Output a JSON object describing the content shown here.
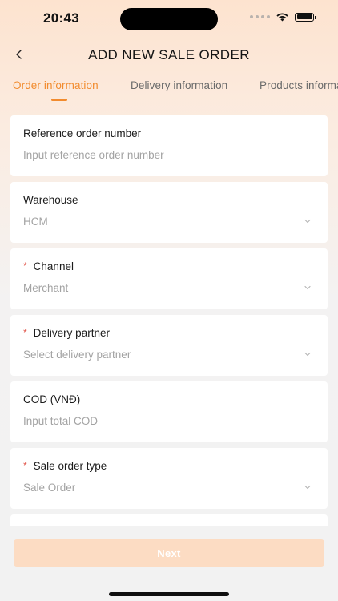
{
  "status_bar": {
    "time": "20:43"
  },
  "header": {
    "title": "ADD NEW SALE ORDER",
    "back_icon": "chevron-left-icon"
  },
  "tabs": [
    {
      "label": "Order information",
      "active": true
    },
    {
      "label": "Delivery information",
      "active": false
    },
    {
      "label": "Products information",
      "active": false
    }
  ],
  "form": {
    "required_marker": "*",
    "fields": [
      {
        "label": "Reference order number",
        "placeholder": "Input reference order number",
        "value": "",
        "required": false,
        "type": "text"
      },
      {
        "label": "Warehouse",
        "placeholder": "",
        "value": "HCM",
        "required": false,
        "type": "select"
      },
      {
        "label": "Channel",
        "placeholder": "",
        "value": "Merchant",
        "required": true,
        "type": "select"
      },
      {
        "label": "Delivery partner",
        "placeholder": "Select delivery partner",
        "value": "",
        "required": true,
        "type": "select"
      },
      {
        "label": "COD (VNĐ)",
        "placeholder": "Input total COD",
        "value": "",
        "required": false,
        "type": "text"
      },
      {
        "label": "Sale order type",
        "placeholder": "",
        "value": "Sale Order",
        "required": true,
        "type": "select"
      }
    ]
  },
  "footer": {
    "next_label": "Next",
    "next_enabled": false
  },
  "colors": {
    "accent": "#f28b2e",
    "required": "#e2574c",
    "button_disabled": "#fcdcc3",
    "placeholder": "#a3a3a3"
  }
}
